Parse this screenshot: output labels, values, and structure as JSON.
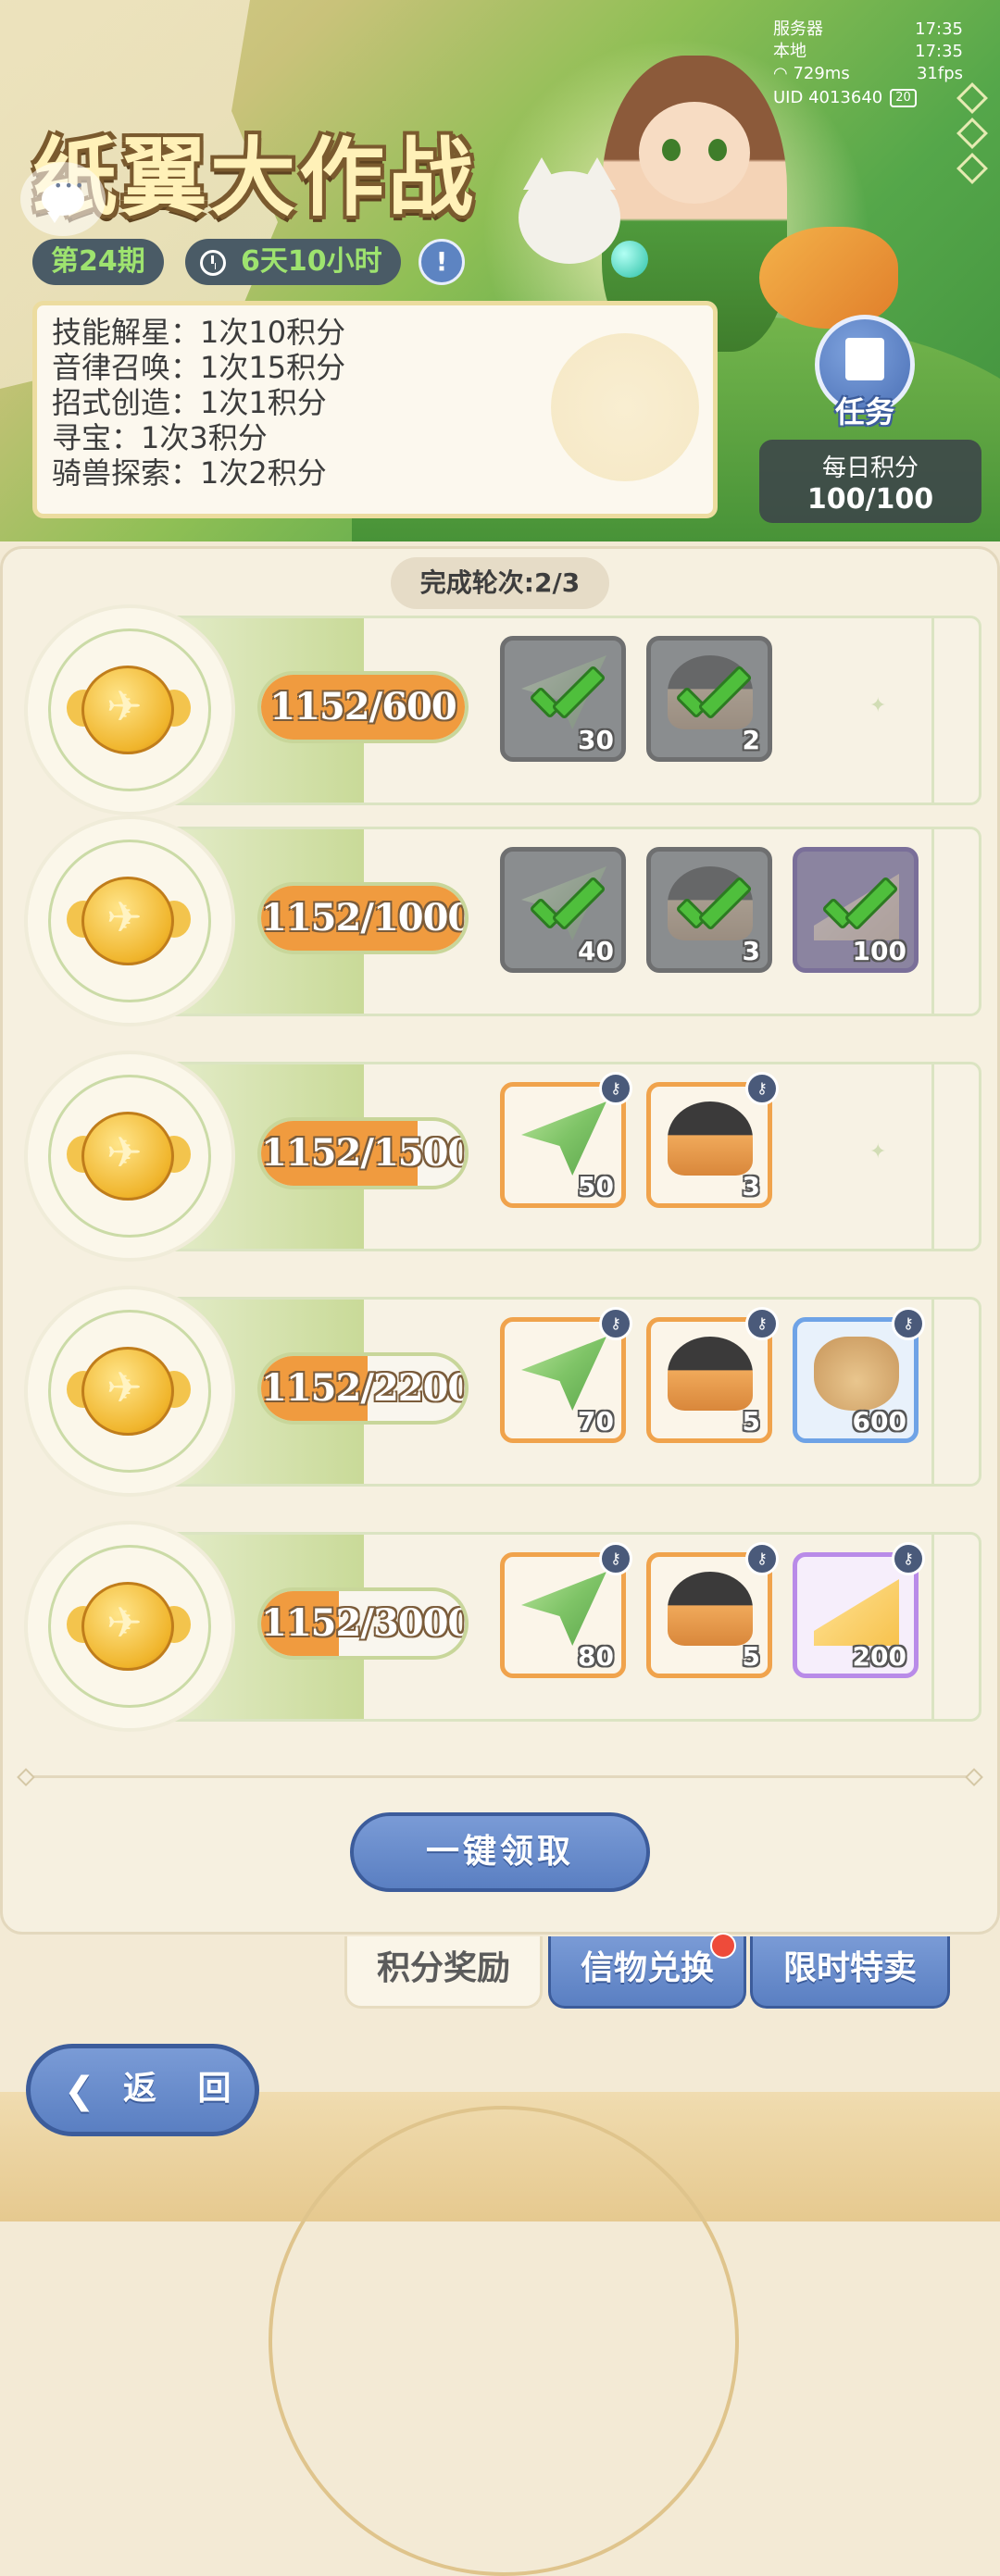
{
  "header": {
    "title": "纸翼大作战",
    "period": "第24期",
    "timer": "6天10小时",
    "info_icon": "exclamation-icon",
    "stats": {
      "server_label": "服务器",
      "server_time": "17:35",
      "local_label": "本地",
      "local_time": "17:35",
      "ping": "729ms",
      "fps": "31fps",
      "uid": "UID 4013640",
      "battery": "20"
    },
    "rules": [
      "技能解星：1次10积分",
      "音律召唤：1次15积分",
      "招式创造：1次1积分",
      "寻宝：1次3积分",
      "骑兽探索：1次2积分"
    ],
    "task_label": "任务",
    "daily_label": "每日积分",
    "daily_value": "100/100"
  },
  "round_label": "完成轮次:2/3",
  "rewards": [
    {
      "progress": "1152/600",
      "fill": 1.0,
      "items": [
        {
          "icon": "paper-plane-icon",
          "qty": "30",
          "claimed": true
        },
        {
          "icon": "bell-icon",
          "qty": "2",
          "claimed": true
        }
      ]
    },
    {
      "progress": "1152/1000",
      "fill": 1.0,
      "items": [
        {
          "icon": "paper-plane-icon",
          "qty": "40",
          "claimed": true
        },
        {
          "icon": "bell-icon",
          "qty": "3",
          "claimed": true
        },
        {
          "icon": "cheese-icon",
          "qty": "100",
          "claimed": true
        }
      ]
    },
    {
      "progress": "1152/1500",
      "fill": 0.768,
      "items": [
        {
          "icon": "paper-plane-icon",
          "qty": "50",
          "claimed": false
        },
        {
          "icon": "bell-icon",
          "qty": "3",
          "claimed": false
        }
      ]
    },
    {
      "progress": "1152/2200",
      "fill": 0.524,
      "items": [
        {
          "icon": "paper-plane-icon",
          "qty": "70",
          "claimed": false
        },
        {
          "icon": "bell-icon",
          "qty": "5",
          "claimed": false
        },
        {
          "icon": "bag-icon",
          "qty": "600",
          "claimed": false
        }
      ]
    },
    {
      "progress": "1152/3000",
      "fill": 0.384,
      "items": [
        {
          "icon": "paper-plane-icon",
          "qty": "80",
          "claimed": false
        },
        {
          "icon": "bell-icon",
          "qty": "5",
          "claimed": false
        },
        {
          "icon": "cheese-icon",
          "qty": "200",
          "claimed": false
        }
      ]
    }
  ],
  "claim_all_label": "一键领取",
  "tabs": [
    {
      "label": "积分奖励",
      "active": true
    },
    {
      "label": "信物兑换",
      "active": false,
      "badge": true
    },
    {
      "label": "限时特卖",
      "active": false
    }
  ],
  "back_label": "返 回",
  "colors": {
    "accent_blue": "#5a7fc2",
    "progress_orange": "#f09b3f",
    "period_green": "#9ee36f"
  }
}
